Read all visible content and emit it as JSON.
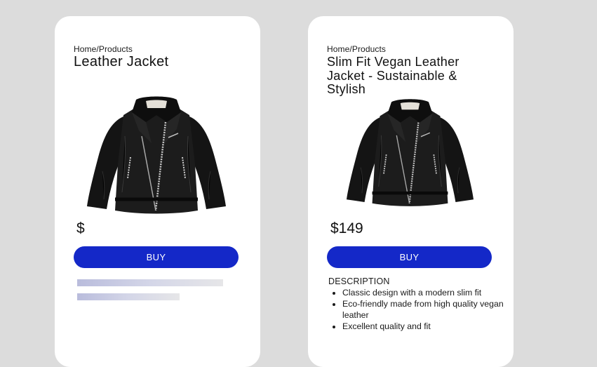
{
  "cards": [
    {
      "breadcrumb": "Home/Products",
      "title": "Leather Jacket",
      "price": "$",
      "buy_label": "BUY",
      "image_icon": "leather-jacket"
    },
    {
      "breadcrumb": "Home/Products",
      "title": "Slim Fit Vegan Leather Jacket - Sustainable & Stylish",
      "price": "$149",
      "buy_label": "BUY",
      "image_icon": "leather-jacket",
      "description": {
        "heading": "DESCRIPTION",
        "items": [
          "Classic design with a modern slim fit",
          "Eco-friendly made from high quality vegan leather",
          "Excellent quality and fit"
        ]
      }
    }
  ],
  "colors": {
    "background": "#dcdcdc",
    "card": "#ffffff",
    "buy_button": "#1428c8",
    "skeleton": "#b9bcdc"
  }
}
